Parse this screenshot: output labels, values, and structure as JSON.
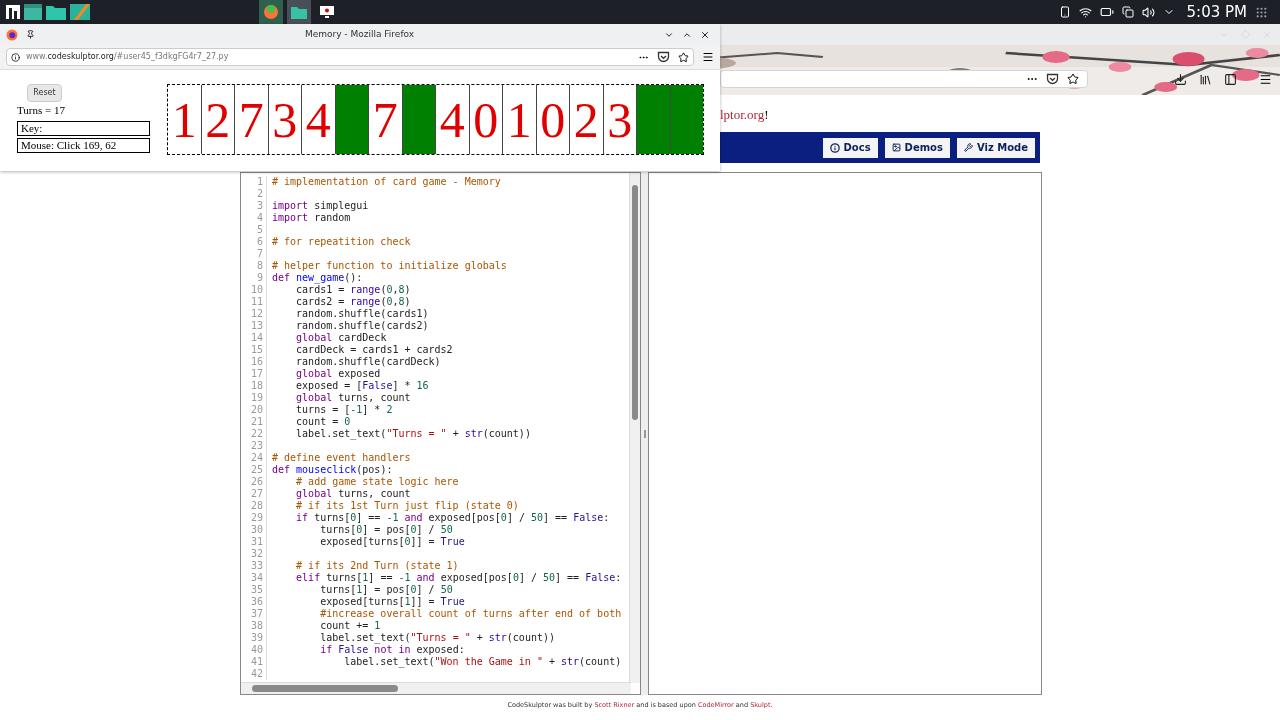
{
  "taskbar": {
    "clock": "5:03 PM"
  },
  "main_window": {
    "page_link_tail": "lptor.org",
    "page_link_after": "!",
    "nav_buttons": [
      {
        "kind": "docs",
        "label": "Docs"
      },
      {
        "kind": "demos",
        "label": "Demos"
      },
      {
        "kind": "viz",
        "label": "Viz Mode"
      }
    ]
  },
  "popup_window": {
    "title": "Memory - Mozilla Firefox",
    "url": {
      "prefix": "www.",
      "domain": "codeskulptor.org",
      "path": "/#user45_f3dkgFG4r7_27.py"
    }
  },
  "game": {
    "reset_label": "Reset",
    "turns_label": "Turns = 17",
    "key_label": "Key:",
    "mouse_label": "Mouse: Click 169, 62",
    "cards": [
      {
        "value": "1",
        "exposed": true
      },
      {
        "value": "2",
        "exposed": true
      },
      {
        "value": "7",
        "exposed": true
      },
      {
        "value": "3",
        "exposed": true
      },
      {
        "value": "4",
        "exposed": true
      },
      {
        "exposed": false
      },
      {
        "value": "7",
        "exposed": true
      },
      {
        "exposed": false
      },
      {
        "value": "4",
        "exposed": true
      },
      {
        "value": "0",
        "exposed": true
      },
      {
        "value": "1",
        "exposed": true
      },
      {
        "value": "0",
        "exposed": true
      },
      {
        "value": "2",
        "exposed": true
      },
      {
        "value": "3",
        "exposed": true
      },
      {
        "exposed": false
      },
      {
        "exposed": false
      }
    ]
  },
  "editor": {
    "lines": [
      {
        "num": "1",
        "tokens": [
          {
            "kind": "comment",
            "text": "# implementation of card game - Memory"
          }
        ]
      },
      {
        "num": "2"
      },
      {
        "num": "3",
        "tokens": [
          {
            "kind": "keyword",
            "text": "import"
          },
          {
            "kind": "plain",
            "text": " simplegui"
          }
        ]
      },
      {
        "num": "4",
        "tokens": [
          {
            "kind": "keyword",
            "text": "import"
          },
          {
            "kind": "plain",
            "text": " random"
          }
        ]
      },
      {
        "num": "5"
      },
      {
        "num": "6",
        "tokens": [
          {
            "kind": "comment",
            "text": "# for repeatition check"
          }
        ]
      },
      {
        "num": "7"
      },
      {
        "num": "8",
        "tokens": [
          {
            "kind": "comment",
            "text": "# helper function to initialize globals"
          }
        ]
      },
      {
        "num": "9",
        "tokens": [
          {
            "kind": "keyword",
            "text": "def"
          },
          {
            "kind": "def",
            "text": " new_game"
          },
          {
            "kind": "plain",
            "text": "():"
          }
        ]
      },
      {
        "num": "10",
        "tokens": [
          {
            "kind": "plain",
            "text": "    cards1 = "
          },
          {
            "kind": "builtin",
            "text": "range"
          },
          {
            "kind": "plain",
            "text": "("
          },
          {
            "kind": "number",
            "text": "0"
          },
          {
            "kind": "plain",
            "text": ","
          },
          {
            "kind": "number",
            "text": "8"
          },
          {
            "kind": "plain",
            "text": ")"
          }
        ]
      },
      {
        "num": "11",
        "tokens": [
          {
            "kind": "plain",
            "text": "    cards2 = "
          },
          {
            "kind": "builtin",
            "text": "range"
          },
          {
            "kind": "plain",
            "text": "("
          },
          {
            "kind": "number",
            "text": "0"
          },
          {
            "kind": "plain",
            "text": ","
          },
          {
            "kind": "number",
            "text": "8"
          },
          {
            "kind": "plain",
            "text": ")"
          }
        ]
      },
      {
        "num": "12",
        "tokens": [
          {
            "kind": "plain",
            "text": "    random.shuffle(cards1)"
          }
        ]
      },
      {
        "num": "13",
        "tokens": [
          {
            "kind": "plain",
            "text": "    random.shuffle(cards2)"
          }
        ]
      },
      {
        "num": "14",
        "tokens": [
          {
            "kind": "keyword",
            "text": "    global"
          },
          {
            "kind": "plain",
            "text": " cardDeck"
          }
        ]
      },
      {
        "num": "15",
        "tokens": [
          {
            "kind": "plain",
            "text": "    cardDeck = cards1 + cards2"
          }
        ]
      },
      {
        "num": "16",
        "tokens": [
          {
            "kind": "plain",
            "text": "    random.shuffle(cardDeck)"
          }
        ]
      },
      {
        "num": "17",
        "tokens": [
          {
            "kind": "keyword",
            "text": "    global"
          },
          {
            "kind": "plain",
            "text": " exposed"
          }
        ]
      },
      {
        "num": "18",
        "tokens": [
          {
            "kind": "plain",
            "text": "    exposed = ["
          },
          {
            "kind": "atom",
            "text": "False"
          },
          {
            "kind": "plain",
            "text": "] * "
          },
          {
            "kind": "number",
            "text": "16"
          }
        ]
      },
      {
        "num": "19",
        "tokens": [
          {
            "kind": "keyword",
            "text": "    global"
          },
          {
            "kind": "plain",
            "text": " turns, count"
          }
        ]
      },
      {
        "num": "20",
        "tokens": [
          {
            "kind": "plain",
            "text": "    turns = ["
          },
          {
            "kind": "number",
            "text": "-1"
          },
          {
            "kind": "plain",
            "text": "] * "
          },
          {
            "kind": "number",
            "text": "2"
          }
        ]
      },
      {
        "num": "21",
        "tokens": [
          {
            "kind": "plain",
            "text": "    count = "
          },
          {
            "kind": "number",
            "text": "0"
          }
        ]
      },
      {
        "num": "22",
        "tokens": [
          {
            "kind": "plain",
            "text": "    label.set_text("
          },
          {
            "kind": "string",
            "text": "\"Turns = \""
          },
          {
            "kind": "plain",
            "text": " + "
          },
          {
            "kind": "builtin",
            "text": "str"
          },
          {
            "kind": "plain",
            "text": "(count))"
          }
        ]
      },
      {
        "num": "23"
      },
      {
        "num": "24",
        "tokens": [
          {
            "kind": "comment",
            "text": "# define event handlers"
          }
        ]
      },
      {
        "num": "25",
        "tokens": [
          {
            "kind": "keyword",
            "text": "def"
          },
          {
            "kind": "def",
            "text": " mouseclick"
          },
          {
            "kind": "plain",
            "text": "(pos):"
          }
        ]
      },
      {
        "num": "26",
        "tokens": [
          {
            "kind": "comment",
            "text": "    # add game state logic here"
          }
        ]
      },
      {
        "num": "27",
        "tokens": [
          {
            "kind": "keyword",
            "text": "    global"
          },
          {
            "kind": "plain",
            "text": " turns, count"
          }
        ]
      },
      {
        "num": "28",
        "tokens": [
          {
            "kind": "comment",
            "text": "    # if its 1st Turn just flip (state 0)"
          }
        ]
      },
      {
        "num": "29",
        "tokens": [
          {
            "kind": "keyword",
            "text": "    if"
          },
          {
            "kind": "plain",
            "text": " turns["
          },
          {
            "kind": "number",
            "text": "0"
          },
          {
            "kind": "plain",
            "text": "] == "
          },
          {
            "kind": "number",
            "text": "-1"
          },
          {
            "kind": "keyword",
            "text": " and"
          },
          {
            "kind": "plain",
            "text": " exposed[pos["
          },
          {
            "kind": "number",
            "text": "0"
          },
          {
            "kind": "plain",
            "text": "] / "
          },
          {
            "kind": "number",
            "text": "50"
          },
          {
            "kind": "plain",
            "text": "] == "
          },
          {
            "kind": "atom",
            "text": "False"
          },
          {
            "kind": "plain",
            "text": ":"
          }
        ]
      },
      {
        "num": "30",
        "tokens": [
          {
            "kind": "plain",
            "text": "        turns["
          },
          {
            "kind": "number",
            "text": "0"
          },
          {
            "kind": "plain",
            "text": "] = pos["
          },
          {
            "kind": "number",
            "text": "0"
          },
          {
            "kind": "plain",
            "text": "] / "
          },
          {
            "kind": "number",
            "text": "50"
          }
        ]
      },
      {
        "num": "31",
        "tokens": [
          {
            "kind": "plain",
            "text": "        exposed[turns["
          },
          {
            "kind": "number",
            "text": "0"
          },
          {
            "kind": "plain",
            "text": "]] = "
          },
          {
            "kind": "atom",
            "text": "True"
          }
        ]
      },
      {
        "num": "32"
      },
      {
        "num": "33",
        "tokens": [
          {
            "kind": "comment",
            "text": "    # if its 2nd Turn (state 1)"
          }
        ]
      },
      {
        "num": "34",
        "tokens": [
          {
            "kind": "keyword",
            "text": "    elif"
          },
          {
            "kind": "plain",
            "text": " turns["
          },
          {
            "kind": "number",
            "text": "1"
          },
          {
            "kind": "plain",
            "text": "] == "
          },
          {
            "kind": "number",
            "text": "-1"
          },
          {
            "kind": "keyword",
            "text": " and"
          },
          {
            "kind": "plain",
            "text": " exposed[pos["
          },
          {
            "kind": "number",
            "text": "0"
          },
          {
            "kind": "plain",
            "text": "] / "
          },
          {
            "kind": "number",
            "text": "50"
          },
          {
            "kind": "plain",
            "text": "] == "
          },
          {
            "kind": "atom",
            "text": "False"
          },
          {
            "kind": "plain",
            "text": ":"
          }
        ]
      },
      {
        "num": "35",
        "tokens": [
          {
            "kind": "plain",
            "text": "        turns["
          },
          {
            "kind": "number",
            "text": "1"
          },
          {
            "kind": "plain",
            "text": "] = pos["
          },
          {
            "kind": "number",
            "text": "0"
          },
          {
            "kind": "plain",
            "text": "] / "
          },
          {
            "kind": "number",
            "text": "50"
          }
        ]
      },
      {
        "num": "36",
        "tokens": [
          {
            "kind": "plain",
            "text": "        exposed[turns["
          },
          {
            "kind": "number",
            "text": "1"
          },
          {
            "kind": "plain",
            "text": "]] = "
          },
          {
            "kind": "atom",
            "text": "True"
          }
        ]
      },
      {
        "num": "37",
        "tokens": [
          {
            "kind": "comment",
            "text": "        #increase overall count of turns after end of both"
          }
        ]
      },
      {
        "num": "38",
        "tokens": [
          {
            "kind": "plain",
            "text": "        count += "
          },
          {
            "kind": "number",
            "text": "1"
          }
        ]
      },
      {
        "num": "39",
        "tokens": [
          {
            "kind": "plain",
            "text": "        label.set_text("
          },
          {
            "kind": "string",
            "text": "\"Turns = \""
          },
          {
            "kind": "plain",
            "text": " + "
          },
          {
            "kind": "builtin",
            "text": "str"
          },
          {
            "kind": "plain",
            "text": "(count))"
          }
        ]
      },
      {
        "num": "40",
        "tokens": [
          {
            "kind": "keyword",
            "text": "        if"
          },
          {
            "kind": "atom",
            "text": " False"
          },
          {
            "kind": "keyword",
            "text": " not in"
          },
          {
            "kind": "plain",
            "text": " exposed:"
          }
        ]
      },
      {
        "num": "41",
        "tokens": [
          {
            "kind": "plain",
            "text": "            label.set_text("
          },
          {
            "kind": "string",
            "text": "\"Won the Game in \""
          },
          {
            "kind": "plain",
            "text": " + "
          },
          {
            "kind": "builtin",
            "text": "str"
          },
          {
            "kind": "plain",
            "text": "(count)"
          }
        ]
      },
      {
        "num": "42"
      }
    ]
  },
  "footer": {
    "text_1": "CodeSkulptor was built by",
    "link_1": "Scott Rixner",
    "text_2": "and is based upon",
    "link_2": "CodeMirror",
    "text_3": "and",
    "link_3": "Skulpt",
    "text_4": "."
  }
}
